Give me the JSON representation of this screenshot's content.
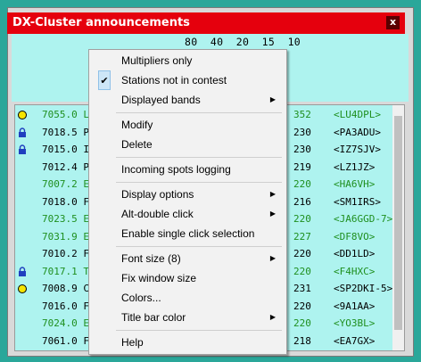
{
  "window": {
    "title": "DX-Cluster announcements",
    "close_label": "x"
  },
  "bands": {
    "labels": "80  40  20  15  10"
  },
  "spots": [
    {
      "icon": "circle",
      "freq": "7055.0 L",
      "tail": "352",
      "call": "<LU4DPL>",
      "color": "green"
    },
    {
      "icon": "lock",
      "freq": "7018.5 P",
      "tail": "230",
      "call": "<PA3ADU>",
      "color": "black"
    },
    {
      "icon": "lock",
      "freq": "7015.0 I",
      "tail": "230",
      "call": "<IZ7SJV>",
      "color": "black"
    },
    {
      "icon": "moon",
      "freq": "7012.4 P",
      "tail": "219",
      "call": "<LZ1JZ>",
      "color": "black"
    },
    {
      "icon": "moon",
      "freq": "7007.2 E",
      "tail": "220",
      "call": "<HA6VH>",
      "color": "green"
    },
    {
      "icon": "moon",
      "freq": "7018.0 F",
      "tail": "216",
      "call": "<SM1IRS>",
      "color": "black"
    },
    {
      "icon": "moon",
      "freq": "7023.5 E",
      "tail": "220",
      "call": "<JA6GGD-7>",
      "color": "green"
    },
    {
      "icon": "moon",
      "freq": "7031.9 E",
      "tail": "227",
      "call": "<DF8VO>",
      "color": "green"
    },
    {
      "icon": "moon",
      "freq": "7010.2 F",
      "tail": "220",
      "call": "<DD1LD>",
      "color": "black"
    },
    {
      "icon": "lock",
      "freq": "7017.1 T",
      "tail": "220",
      "call": "<F4HXC>",
      "color": "green"
    },
    {
      "icon": "circle",
      "freq": "7008.9 C",
      "tail": "231",
      "call": "<SP2DKI-5>",
      "color": "black"
    },
    {
      "icon": "moon",
      "freq": "7016.0 F",
      "tail": "220",
      "call": "<9A1AA>",
      "color": "black"
    },
    {
      "icon": "moon",
      "freq": "7024.0 E",
      "tail": "220",
      "call": "<YO3BL>",
      "color": "green"
    },
    {
      "icon": "moon",
      "freq": "7061.0 F",
      "tail": "218",
      "call": "<EA7GX>",
      "color": "black"
    }
  ],
  "menu": {
    "items": [
      {
        "label": "Multipliers only",
        "checked": false,
        "submenu": false
      },
      {
        "label": "Stations not in contest",
        "checked": true,
        "submenu": false
      },
      {
        "label": "Displayed bands",
        "checked": false,
        "submenu": true
      },
      {
        "label": "Modify",
        "checked": false,
        "submenu": false
      },
      {
        "label": "Delete",
        "checked": false,
        "submenu": false
      },
      {
        "label": "Incoming spots logging",
        "checked": false,
        "submenu": false
      },
      {
        "label": "Display options",
        "checked": false,
        "submenu": true
      },
      {
        "label": "Alt-double click",
        "checked": false,
        "submenu": true
      },
      {
        "label": "Enable single click selection",
        "checked": false,
        "submenu": false
      },
      {
        "label": "Font size (8)",
        "checked": false,
        "submenu": true
      },
      {
        "label": "Fix window size",
        "checked": false,
        "submenu": false
      },
      {
        "label": "Colors...",
        "checked": false,
        "submenu": false
      },
      {
        "label": "Title bar color",
        "checked": false,
        "submenu": true
      },
      {
        "label": "Help",
        "checked": false,
        "submenu": false
      }
    ]
  },
  "colors": {
    "title_bar": "#e5000d",
    "list_bg": "#aef3ef",
    "green_text": "#1f8f1f"
  }
}
